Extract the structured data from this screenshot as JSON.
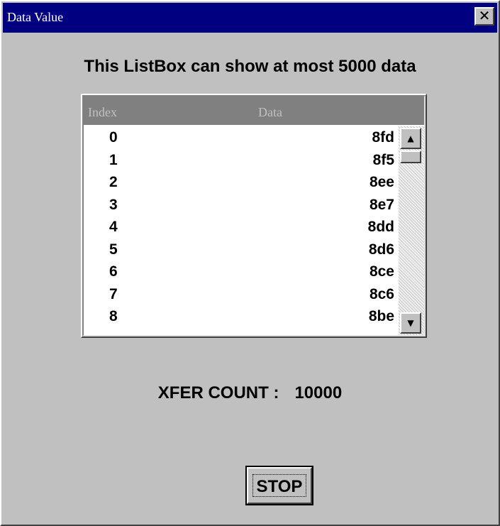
{
  "window": {
    "title": "Data Value",
    "close_symbol": "✕"
  },
  "heading": "This ListBox can show at most 5000 data",
  "listbox": {
    "columns": [
      "Index",
      "Data"
    ],
    "rows": [
      {
        "index": "0",
        "data": "8fd"
      },
      {
        "index": "1",
        "data": "8f5"
      },
      {
        "index": "2",
        "data": "8ee"
      },
      {
        "index": "3",
        "data": "8e7"
      },
      {
        "index": "4",
        "data": "8dd"
      },
      {
        "index": "5",
        "data": "8d6"
      },
      {
        "index": "6",
        "data": "8ce"
      },
      {
        "index": "7",
        "data": "8c6"
      },
      {
        "index": "8",
        "data": "8be"
      }
    ],
    "scroll_up_symbol": "▲",
    "scroll_down_symbol": "▼"
  },
  "xfer": {
    "label": "XFER COUNT :",
    "value": "10000"
  },
  "stop_button": {
    "label": "STOP"
  },
  "colors": {
    "titlebar": "#000080",
    "window_bg": "#c0c0c0",
    "header_bg": "#808080"
  }
}
